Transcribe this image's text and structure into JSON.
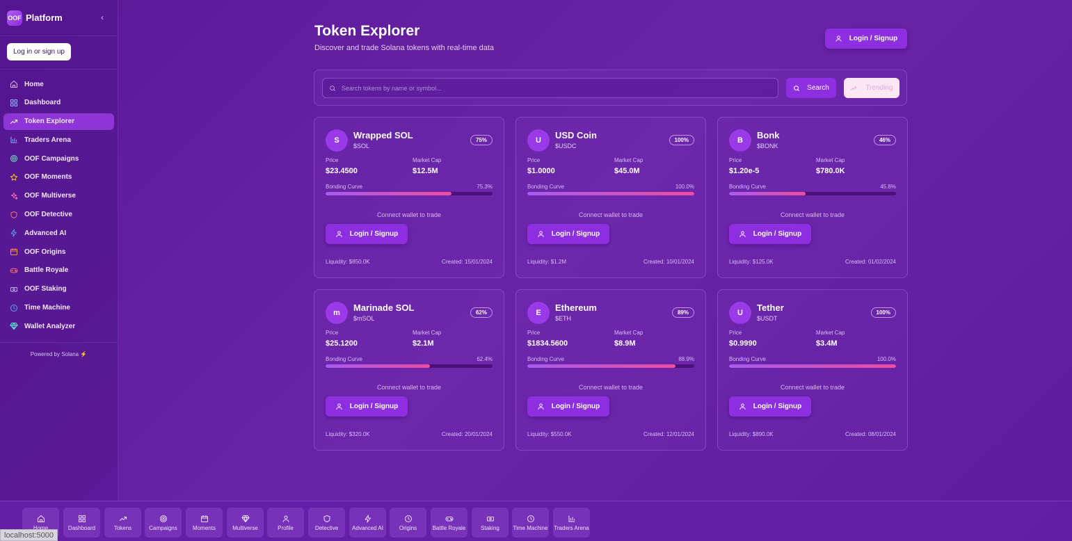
{
  "sidebar": {
    "brand_logo": "OOF",
    "brand_name": "Platform",
    "collapse_icon": "‹",
    "login_label": "Log in or sign up",
    "items": [
      {
        "label": "Home",
        "icon": "home-icon",
        "color": "#d8b8ff"
      },
      {
        "label": "Dashboard",
        "icon": "dashboard-icon",
        "color": "#8fb4ff"
      },
      {
        "label": "Token Explorer",
        "icon": "trending-icon",
        "color": "#ffffff",
        "active": true
      },
      {
        "label": "Traders Arena",
        "icon": "bar-chart-icon",
        "color": "#8fb4ff"
      },
      {
        "label": "OOF Campaigns",
        "icon": "target-icon",
        "color": "#6ee7b7"
      },
      {
        "label": "OOF Moments",
        "icon": "star-icon",
        "color": "#facc15"
      },
      {
        "label": "OOF Multiverse",
        "icon": "sparkles-icon",
        "color": "#f472b6"
      },
      {
        "label": "OOF Detective",
        "icon": "shield-icon",
        "color": "#f87171"
      },
      {
        "label": "Advanced AI",
        "icon": "zap-icon",
        "color": "#60a5fa"
      },
      {
        "label": "OOF Origins",
        "icon": "calendar-icon",
        "color": "#fb923c"
      },
      {
        "label": "Battle Royale",
        "icon": "gamepad-icon",
        "color": "#f87171"
      },
      {
        "label": "OOF Staking",
        "icon": "coins-icon",
        "color": "#c4b5fd"
      },
      {
        "label": "Time Machine",
        "icon": "clock-icon",
        "color": "#60a5fa"
      },
      {
        "label": "Wallet Analyzer",
        "icon": "gem-icon",
        "color": "#5eead4"
      }
    ],
    "powered_by": "Powered by Solana ⚡"
  },
  "header": {
    "title": "Token Explorer",
    "subtitle": "Discover and trade Solana tokens with real-time data",
    "login_label": "Login / Signup"
  },
  "search": {
    "placeholder": "Search tokens by name or symbol...",
    "button_label": "Search",
    "trending_label": "Trending"
  },
  "labels": {
    "price": "Price",
    "market_cap": "Market Cap",
    "bonding_curve": "Bonding Curve",
    "connect": "Connect wallet to trade",
    "login": "Login / Signup"
  },
  "tokens": [
    {
      "initial": "S",
      "name": "Wrapped SOL",
      "symbol": "$SOL",
      "badge": "75%",
      "price": "$23.4500",
      "market_cap": "$12.5M",
      "curve_pct": "75.3%",
      "curve_value": 75.3,
      "liquidity": "Liquidity: $850.0K",
      "created": "Created: 15/01/2024"
    },
    {
      "initial": "U",
      "name": "USD Coin",
      "symbol": "$USDC",
      "badge": "100%",
      "price": "$1.0000",
      "market_cap": "$45.0M",
      "curve_pct": "100.0%",
      "curve_value": 100.0,
      "liquidity": "Liquidity: $1.2M",
      "created": "Created: 10/01/2024"
    },
    {
      "initial": "B",
      "name": "Bonk",
      "symbol": "$BONK",
      "badge": "46%",
      "price": "$1.20e-5",
      "market_cap": "$780.0K",
      "curve_pct": "45.8%",
      "curve_value": 45.8,
      "liquidity": "Liquidity: $125.0K",
      "created": "Created: 01/02/2024"
    },
    {
      "initial": "m",
      "name": "Marinade SOL",
      "symbol": "$mSOL",
      "badge": "62%",
      "price": "$25.1200",
      "market_cap": "$2.1M",
      "curve_pct": "62.4%",
      "curve_value": 62.4,
      "liquidity": "Liquidity: $320.0K",
      "created": "Created: 20/01/2024"
    },
    {
      "initial": "E",
      "name": "Ethereum",
      "symbol": "$ETH",
      "badge": "89%",
      "price": "$1834.5600",
      "market_cap": "$8.9M",
      "curve_pct": "88.9%",
      "curve_value": 88.9,
      "liquidity": "Liquidity: $550.0K",
      "created": "Created: 12/01/2024"
    },
    {
      "initial": "U",
      "name": "Tether",
      "symbol": "$USDT",
      "badge": "100%",
      "price": "$0.9990",
      "market_cap": "$3.4M",
      "curve_pct": "100.0%",
      "curve_value": 100.0,
      "liquidity": "Liquidity: $890.0K",
      "created": "Created: 08/01/2024"
    }
  ],
  "bottom_nav": [
    {
      "label": "Home",
      "icon": "home-icon"
    },
    {
      "label": "Dashboard",
      "icon": "dashboard-icon"
    },
    {
      "label": "Tokens",
      "icon": "trending-icon"
    },
    {
      "label": "Campaigns",
      "icon": "target-icon"
    },
    {
      "label": "Moments",
      "icon": "calendar-icon"
    },
    {
      "label": "Multiverse",
      "icon": "gem-icon"
    },
    {
      "label": "Profile",
      "icon": "user-icon"
    },
    {
      "label": "Detective",
      "icon": "shield-icon"
    },
    {
      "label": "Advanced AI",
      "icon": "zap-icon"
    },
    {
      "label": "Origins",
      "icon": "clock-icon"
    },
    {
      "label": "Battle Royale",
      "icon": "gamepad-icon"
    },
    {
      "label": "Staking",
      "icon": "coins-icon"
    },
    {
      "label": "Time Machine",
      "icon": "clock-icon"
    },
    {
      "label": "Traders Arena",
      "icon": "bar-chart-icon"
    }
  ],
  "status_url": "localhost:5000"
}
